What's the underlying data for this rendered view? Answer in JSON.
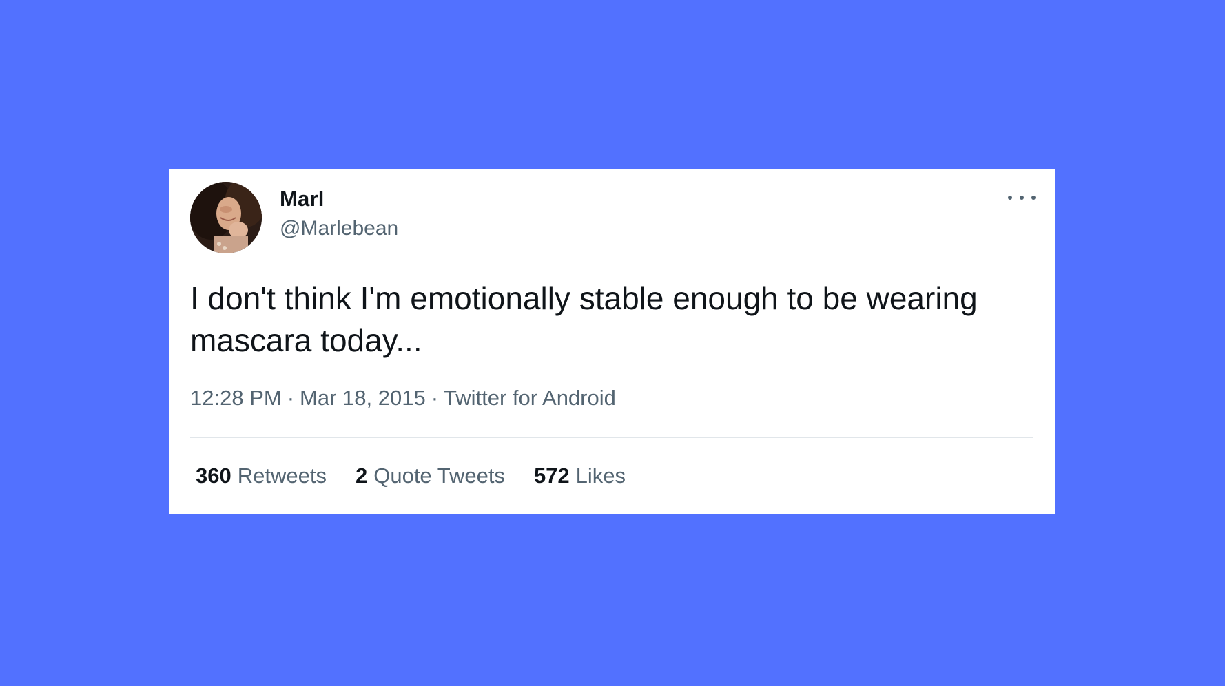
{
  "tweet": {
    "author": {
      "display_name": "Marl",
      "handle": "@Marlebean"
    },
    "text": "I don't think I'm emotionally stable enough to be wearing mascara today...",
    "time": "12:28 PM",
    "date": "Mar 18, 2015",
    "source": "Twitter for Android",
    "separator": "·",
    "stats": {
      "retweets": {
        "count": "360",
        "label": "Retweets"
      },
      "quote_tweets": {
        "count": "2",
        "label": "Quote Tweets"
      },
      "likes": {
        "count": "572",
        "label": "Likes"
      }
    }
  },
  "icons": {
    "more": "more-horizontal-icon",
    "avatar": "profile-photo"
  },
  "colors": {
    "background": "#5271ff",
    "card": "#ffffff",
    "text_primary": "#0f1419",
    "text_secondary": "#536471"
  }
}
